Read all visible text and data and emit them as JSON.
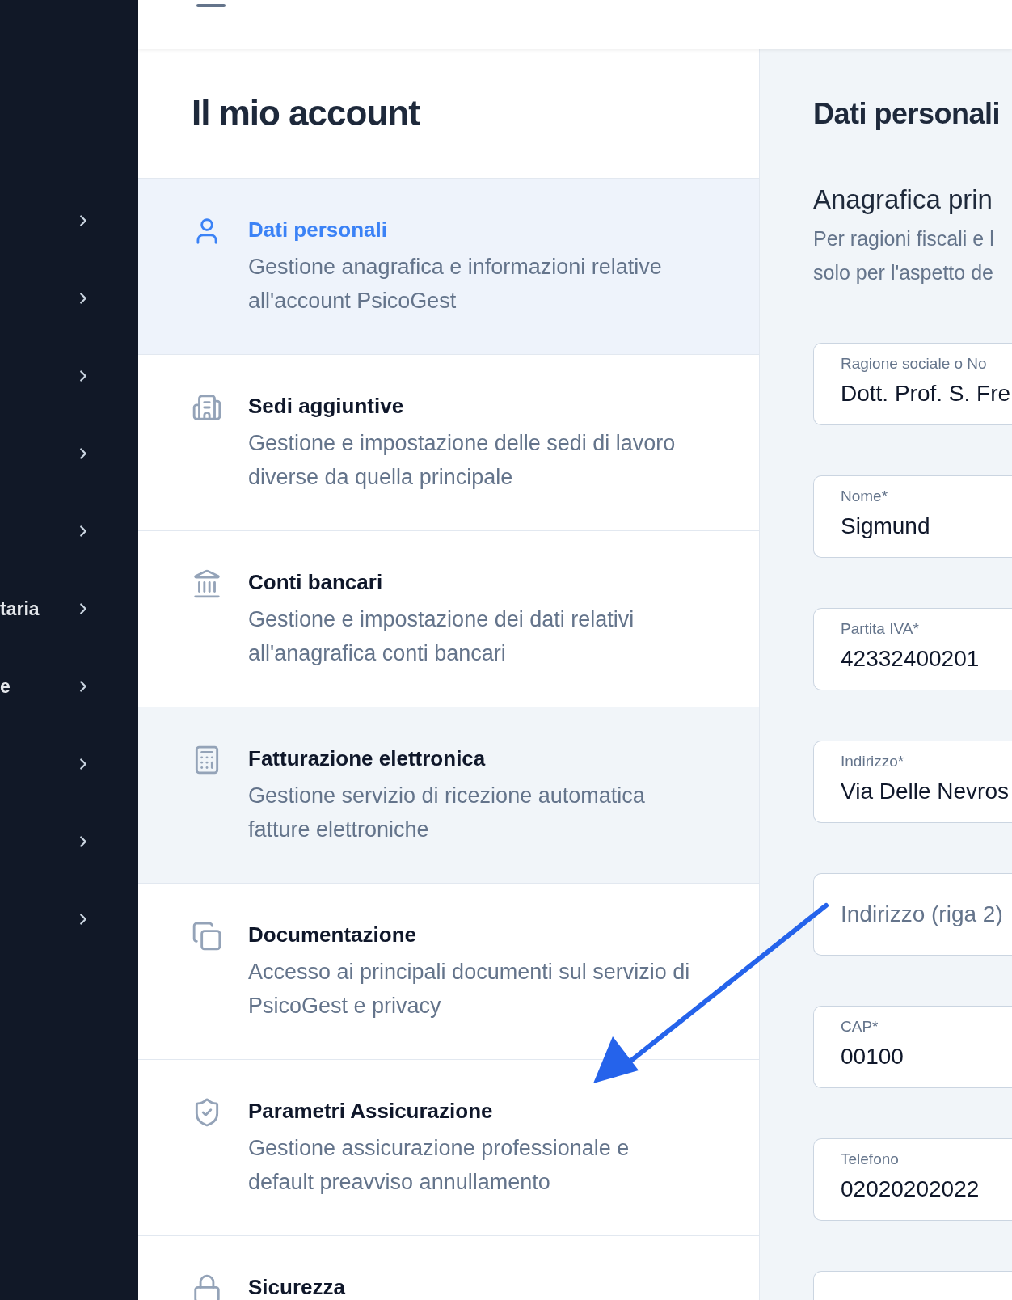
{
  "sidebar": {
    "items": [
      {
        "has_submenu": true
      },
      {
        "has_submenu": true
      },
      {
        "has_submenu": true
      },
      {
        "has_submenu": true
      },
      {
        "has_submenu": true
      },
      {
        "label": "taria",
        "has_submenu": true
      },
      {
        "label": "e",
        "has_submenu": true
      },
      {
        "has_submenu": true
      },
      {
        "has_submenu": true
      },
      {
        "has_submenu": true
      }
    ]
  },
  "account_menu": {
    "title": "Il mio account",
    "items": [
      {
        "title": "Dati personali",
        "description": "Gestione anagrafica e informazioni relative all'account PsicoGest",
        "selected": true,
        "hovered": false
      },
      {
        "title": "Sedi aggiuntive",
        "description": "Gestione e impostazione delle sedi di lavoro diverse da quella principale",
        "selected": false,
        "hovered": false
      },
      {
        "title": "Conti bancari",
        "description": "Gestione e impostazione dei dati relativi all'anagrafica conti bancari",
        "selected": false,
        "hovered": false
      },
      {
        "title": "Fatturazione elettronica",
        "description": "Gestione servizio di ricezione automatica fatture elettroniche",
        "selected": false,
        "hovered": true
      },
      {
        "title": "Documentazione",
        "description": "Accesso ai principali documenti sul servizio di PsicoGest e privacy",
        "selected": false,
        "hovered": false
      },
      {
        "title": "Parametri Assicurazione",
        "description": "Gestione assicurazione professionale e default preavviso annullamento",
        "selected": false,
        "hovered": false
      },
      {
        "title": "Sicurezza",
        "selected": false,
        "hovered": false
      }
    ]
  },
  "details": {
    "title": "Dati personali",
    "section_title": "Anagrafica prin",
    "description_lines": [
      "Per ragioni fiscali e l",
      "solo per l'aspetto de"
    ],
    "fields": [
      {
        "kind": "filled",
        "label": "Ragione sociale o No",
        "value": "Dott. Prof. S. Fre"
      },
      {
        "kind": "filled",
        "label": "Nome*",
        "value": "Sigmund"
      },
      {
        "kind": "filled",
        "label": "Partita IVA*",
        "value": "42332400201"
      },
      {
        "kind": "filled",
        "label": "Indirizzo*",
        "value": "Via Delle Nevros"
      },
      {
        "kind": "placeholder",
        "placeholder": "Indirizzo (riga 2)"
      },
      {
        "kind": "filled",
        "label": "CAP*",
        "value": "00100"
      },
      {
        "kind": "filled",
        "label": "Telefono",
        "value": "02020202022"
      },
      {
        "kind": "blank"
      }
    ]
  }
}
